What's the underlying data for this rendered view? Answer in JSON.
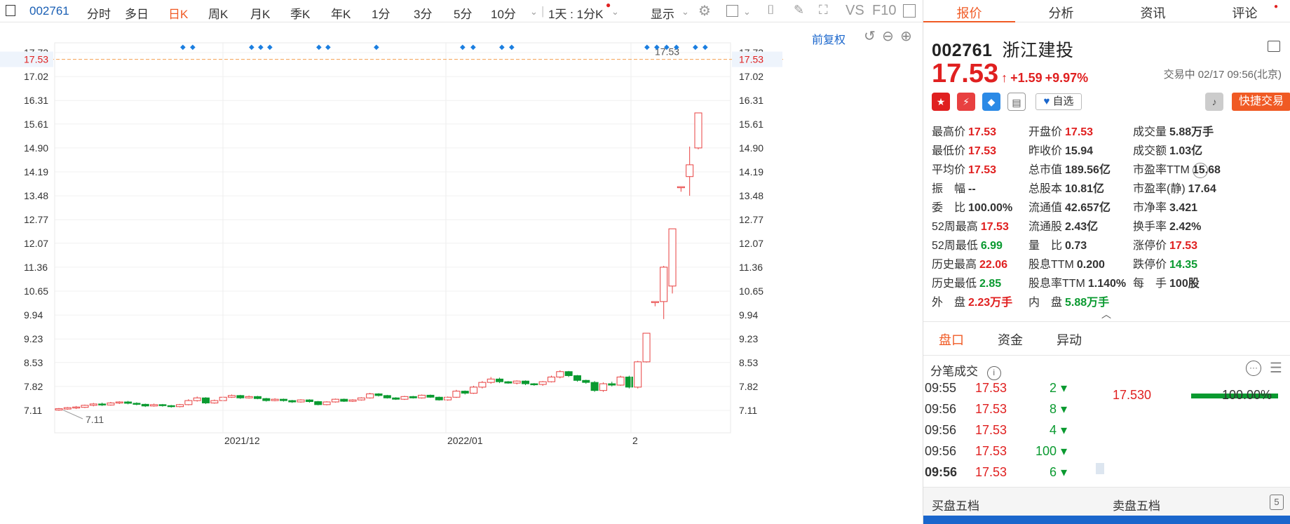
{
  "toolbar": {
    "symbol": "002761",
    "periods": [
      "分时",
      "多日",
      "日K",
      "周K",
      "月K",
      "季K",
      "年K",
      "1分",
      "3分",
      "5分",
      "10分"
    ],
    "active_period": "日K",
    "interval": "1天 : 1分K",
    "display": "显示",
    "vs": "VS",
    "f10": "F10",
    "restore": "前复权"
  },
  "chart_data": {
    "type": "candlestick",
    "y_ticks": [
      "17.73",
      "17.02",
      "16.31",
      "15.61",
      "14.90",
      "14.19",
      "13.48",
      "12.77",
      "12.07",
      "11.36",
      "10.65",
      "9.94",
      "9.23",
      "8.53",
      "7.82",
      "7.11"
    ],
    "ylim": [
      7.11,
      17.73
    ],
    "x_labels": [
      "2021/12",
      "2022/01",
      "2"
    ],
    "current_price_label": "17.53",
    "max_label": "17.53",
    "min_label": "7.11",
    "candles": [
      [
        7.12,
        7.16,
        7.18,
        7.1
      ],
      [
        7.15,
        7.19,
        7.21,
        7.13
      ],
      [
        7.18,
        7.21,
        7.24,
        7.15
      ],
      [
        7.2,
        7.26,
        7.28,
        7.18
      ],
      [
        7.26,
        7.3,
        7.33,
        7.23
      ],
      [
        7.3,
        7.27,
        7.34,
        7.24
      ],
      [
        7.27,
        7.33,
        7.36,
        7.25
      ],
      [
        7.33,
        7.36,
        7.38,
        7.3
      ],
      [
        7.36,
        7.32,
        7.39,
        7.29
      ],
      [
        7.32,
        7.29,
        7.35,
        7.26
      ],
      [
        7.29,
        7.24,
        7.31,
        7.21
      ],
      [
        7.24,
        7.28,
        7.31,
        7.22
      ],
      [
        7.28,
        7.25,
        7.3,
        7.22
      ],
      [
        7.25,
        7.22,
        7.27,
        7.19
      ],
      [
        7.22,
        7.28,
        7.3,
        7.2
      ],
      [
        7.28,
        7.4,
        7.44,
        7.26
      ],
      [
        7.4,
        7.48,
        7.52,
        7.37
      ],
      [
        7.48,
        7.33,
        7.5,
        7.3
      ],
      [
        7.33,
        7.4,
        7.43,
        7.31
      ],
      [
        7.4,
        7.5,
        7.54,
        7.38
      ],
      [
        7.5,
        7.55,
        7.58,
        7.48
      ],
      [
        7.55,
        7.48,
        7.57,
        7.45
      ],
      [
        7.48,
        7.52,
        7.55,
        7.46
      ],
      [
        7.52,
        7.46,
        7.54,
        7.44
      ],
      [
        7.46,
        7.4,
        7.48,
        7.37
      ],
      [
        7.4,
        7.44,
        7.47,
        7.38
      ],
      [
        7.44,
        7.4,
        7.46,
        7.37
      ],
      [
        7.4,
        7.36,
        7.42,
        7.33
      ],
      [
        7.36,
        7.42,
        7.44,
        7.34
      ],
      [
        7.42,
        7.37,
        7.44,
        7.34
      ],
      [
        7.37,
        7.28,
        7.39,
        7.26
      ],
      [
        7.28,
        7.36,
        7.38,
        7.26
      ],
      [
        7.36,
        7.44,
        7.46,
        7.34
      ],
      [
        7.44,
        7.38,
        7.46,
        7.36
      ],
      [
        7.38,
        7.42,
        7.44,
        7.36
      ],
      [
        7.42,
        7.48,
        7.5,
        7.4
      ],
      [
        7.48,
        7.6,
        7.63,
        7.46
      ],
      [
        7.6,
        7.55,
        7.62,
        7.52
      ],
      [
        7.55,
        7.48,
        7.57,
        7.46
      ],
      [
        7.48,
        7.44,
        7.5,
        7.42
      ],
      [
        7.44,
        7.52,
        7.54,
        7.42
      ],
      [
        7.52,
        7.48,
        7.54,
        7.46
      ],
      [
        7.48,
        7.56,
        7.58,
        7.46
      ],
      [
        7.56,
        7.5,
        7.58,
        7.48
      ],
      [
        7.5,
        7.42,
        7.52,
        7.4
      ],
      [
        7.42,
        7.5,
        7.52,
        7.4
      ],
      [
        7.5,
        7.68,
        7.72,
        7.48
      ],
      [
        7.68,
        7.62,
        7.7,
        7.58
      ],
      [
        7.62,
        7.8,
        7.84,
        7.6
      ],
      [
        7.8,
        7.94,
        7.98,
        7.76
      ],
      [
        7.94,
        8.04,
        8.1,
        7.9
      ],
      [
        8.04,
        7.96,
        8.08,
        7.92
      ],
      [
        7.96,
        7.92,
        7.98,
        7.9
      ],
      [
        7.92,
        7.98,
        8.0,
        7.88
      ],
      [
        7.98,
        7.9,
        8.0,
        7.86
      ],
      [
        7.9,
        7.88,
        7.92,
        7.84
      ],
      [
        7.88,
        7.96,
        7.98,
        7.84
      ],
      [
        7.96,
        8.1,
        8.14,
        7.94
      ],
      [
        8.1,
        8.26,
        8.3,
        8.06
      ],
      [
        8.26,
        8.14,
        8.28,
        8.1
      ],
      [
        8.14,
        8.0,
        8.16,
        7.96
      ],
      [
        8.0,
        7.94,
        8.02,
        7.9
      ],
      [
        7.94,
        7.7,
        7.98,
        7.66
      ],
      [
        7.7,
        7.9,
        7.94,
        7.66
      ],
      [
        7.9,
        7.86,
        7.96,
        7.82
      ],
      [
        7.86,
        8.1,
        8.14,
        7.84
      ],
      [
        8.1,
        7.8,
        8.14,
        7.76
      ],
      [
        7.8,
        8.55,
        8.58,
        7.76
      ],
      [
        8.55,
        9.4,
        9.4,
        8.53
      ],
      [
        10.34,
        10.34,
        10.34,
        10.2
      ],
      [
        10.34,
        11.36,
        11.4,
        9.82
      ],
      [
        10.8,
        12.5,
        12.5,
        10.58
      ],
      [
        13.75,
        13.75,
        13.75,
        13.6
      ],
      [
        14.05,
        14.4,
        14.94,
        13.48
      ],
      [
        14.9,
        15.94,
        15.94,
        14.86
      ]
    ],
    "dots_label": "◆"
  },
  "quote": {
    "tabs": [
      "报价",
      "分析",
      "资讯",
      "评论"
    ],
    "code": "002761",
    "name": "浙江建投",
    "price": "17.53",
    "arrow": "↑",
    "change": "+1.59",
    "pct": "+9.97%",
    "status": "交易中 02/17 09:56(北京)",
    "watch": "自选",
    "quick_trade": "快捷交易",
    "stats": [
      [
        [
          "最高价",
          "17.53",
          "r"
        ],
        [
          "开盘价",
          "17.53",
          "r"
        ],
        [
          "成交量",
          "5.88万手",
          ""
        ]
      ],
      [
        [
          "最低价",
          "17.53",
          "r"
        ],
        [
          "昨收价",
          "15.94",
          ""
        ],
        [
          "成交额",
          "1.03亿",
          ""
        ]
      ],
      [
        [
          "平均价",
          "17.53",
          "r"
        ],
        [
          "总市值",
          "189.56亿",
          ""
        ],
        [
          "市盈率TTM",
          "15.68",
          ""
        ]
      ],
      [
        [
          "振　幅",
          "--",
          ""
        ],
        [
          "总股本",
          "10.81亿",
          ""
        ],
        [
          "市盈率(静)",
          "17.64",
          ""
        ]
      ],
      [
        [
          "委　比",
          "100.00%",
          ""
        ],
        [
          "流通值",
          "42.657亿",
          ""
        ],
        [
          "市净率",
          "3.421",
          ""
        ]
      ],
      [
        [
          "52周最高",
          "17.53",
          "r"
        ],
        [
          "流通股",
          "2.43亿",
          ""
        ],
        [
          "换手率",
          "2.42%",
          ""
        ]
      ],
      [
        [
          "52周最低",
          "6.99",
          "g"
        ],
        [
          "量　比",
          "0.73",
          ""
        ],
        [
          "涨停价",
          "17.53",
          "r"
        ]
      ],
      [
        [
          "历史最高",
          "22.06",
          "r"
        ],
        [
          "股息TTM",
          "0.200",
          ""
        ],
        [
          "跌停价",
          "14.35",
          "g"
        ]
      ],
      [
        [
          "历史最低",
          "2.85",
          "g"
        ],
        [
          "股息率TTM",
          "1.140%",
          ""
        ],
        [
          "每　手",
          "100股",
          ""
        ]
      ],
      [
        [
          "外　盘",
          "2.23万手",
          "r"
        ],
        [
          "内　盘",
          "5.88万手",
          "g"
        ],
        [
          "",
          "",
          ""
        ]
      ]
    ],
    "subtabs": [
      "盘口",
      "资金",
      "异动"
    ],
    "trades_title": "分笔成交",
    "trades": [
      [
        "09:55",
        "17.53",
        "2"
      ],
      [
        "09:56",
        "17.53",
        "8"
      ],
      [
        "09:56",
        "17.53",
        "4"
      ],
      [
        "09:56",
        "17.53",
        "100"
      ],
      [
        "09:56",
        "17.53",
        "6"
      ]
    ],
    "dist_price": "17.530",
    "dist_pct": "100.00%",
    "orderbook_buy": "买盘五档",
    "orderbook_sell": "卖盘五档"
  }
}
